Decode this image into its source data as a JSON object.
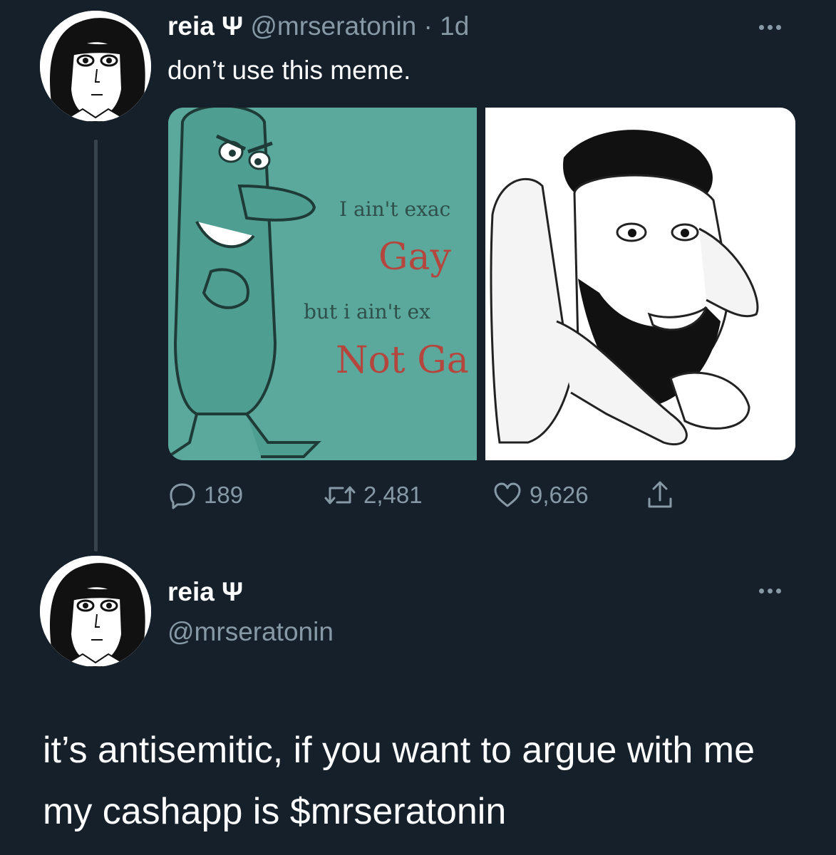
{
  "colors": {
    "background": "#15202b",
    "primary_text": "#ffffff",
    "secondary_text": "#8899a6",
    "thread_line": "#38444d"
  },
  "tweet": {
    "display_name": "reia Ψ",
    "handle": "@mrseratonin",
    "separator": "·",
    "time": "1d",
    "text": "don’t use this meme.",
    "media": {
      "left_panel_text": [
        "I ain't exac",
        "Gay",
        "but i ain't ex",
        "Not Ga"
      ]
    },
    "actions": {
      "replies": "189",
      "retweets": "2,481",
      "likes": "9,626"
    },
    "icons": {
      "reply": "speech-bubble-icon",
      "retweet": "retweet-icon",
      "like": "heart-icon",
      "share": "share-icon",
      "more": "more-icon"
    }
  },
  "reply": {
    "display_name": "reia Ψ",
    "handle": "@mrseratonin",
    "text": "it’s antisemitic, if you want to argue with me my cashapp is $mrseratonin"
  }
}
